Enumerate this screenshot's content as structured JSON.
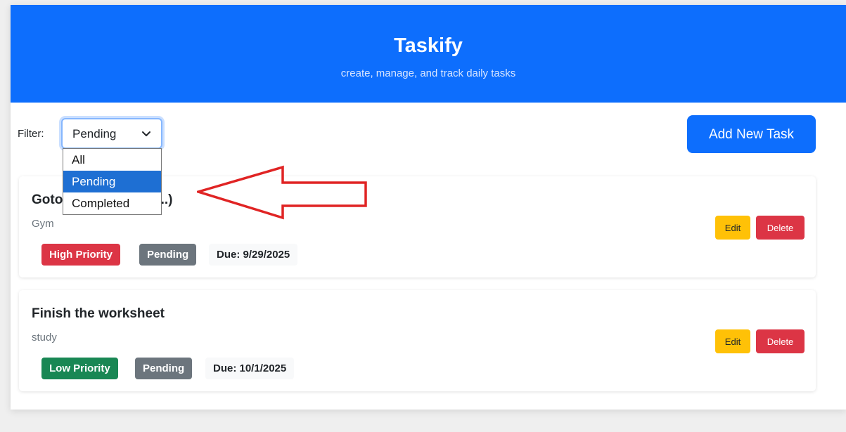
{
  "header": {
    "title": "Taskify",
    "subtitle": "create, manage, and track daily tasks"
  },
  "filter": {
    "label": "Filter:",
    "selected": "Pending",
    "options": [
      "All",
      "Pending",
      "Completed"
    ]
  },
  "add_task_label": "Add New Task",
  "tasks": [
    {
      "title_visible": "Goto",
      "title_visible_end": "...)",
      "description": "Gym",
      "priority": "High Priority",
      "priority_color": "#dc3545",
      "status": "Pending",
      "status_color": "#6c757d",
      "due": "Due: 9/29/2025",
      "edit_label": "Edit",
      "delete_label": "Delete"
    },
    {
      "title": "Finish the worksheet",
      "description": "study",
      "priority": "Low Priority",
      "priority_color": "#198754",
      "status": "Pending",
      "status_color": "#6c757d",
      "due": "Due: 10/1/2025",
      "edit_label": "Edit",
      "delete_label": "Delete"
    }
  ],
  "colors": {
    "primary": "#0d6efd",
    "warning": "#ffc107",
    "danger": "#dc3545",
    "success": "#198754",
    "secondary": "#6c757d",
    "annotation_arrow": "#e02424"
  },
  "icons": {
    "select_chevron": "chevron-down-icon",
    "annotation": "left-arrow-icon"
  }
}
